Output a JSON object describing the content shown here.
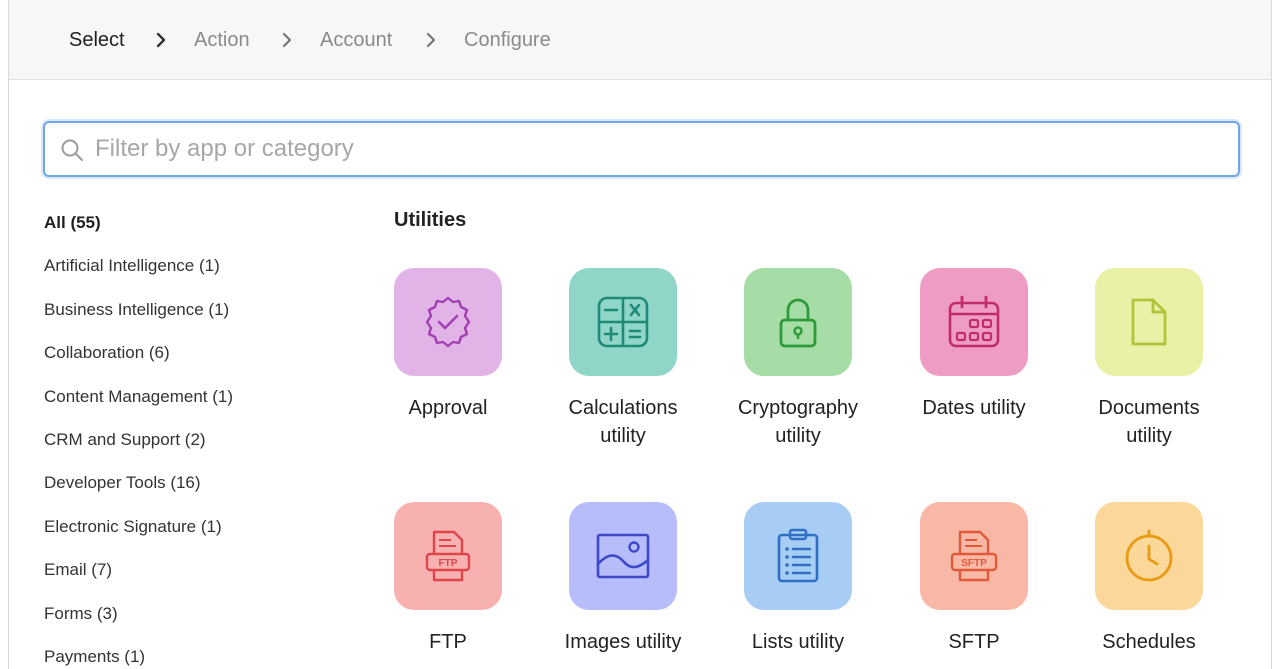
{
  "stepper": {
    "steps": [
      "Select",
      "Action",
      "Account",
      "Configure"
    ],
    "active_index": 0
  },
  "search": {
    "placeholder": "Filter by app or category",
    "value": ""
  },
  "categories": [
    {
      "label": "All (55)",
      "selected": true
    },
    {
      "label": "Artificial Intelligence (1)"
    },
    {
      "label": "Business Intelligence (1)"
    },
    {
      "label": "Collaboration (6)"
    },
    {
      "label": "Content Management (1)"
    },
    {
      "label": "CRM and Support (2)"
    },
    {
      "label": "Developer Tools (16)"
    },
    {
      "label": "Electronic Signature (1)"
    },
    {
      "label": "Email (7)"
    },
    {
      "label": "Forms (3)"
    },
    {
      "label": "Payments (1)"
    }
  ],
  "section": {
    "title": "Utilities"
  },
  "apps": [
    {
      "label": "Approval",
      "icon": "approval-badge-icon",
      "bg": "#e2b3e6",
      "fg": "#a23fb5"
    },
    {
      "label": "Calculations\nutility",
      "icon": "calculator-icon",
      "bg": "#8fd6c9",
      "fg": "#1f8a78"
    },
    {
      "label": "Cryptography\nutility",
      "icon": "lock-icon",
      "bg": "#a6dca6",
      "fg": "#2f9a3a"
    },
    {
      "label": "Dates utility",
      "icon": "calendar-icon",
      "bg": "#ee9cc4",
      "fg": "#c02b6e"
    },
    {
      "label": "Documents\nutility",
      "icon": "document-icon",
      "bg": "#eaf0a6",
      "fg": "#b5c33a"
    },
    {
      "label": "FTP",
      "icon": "ftp-file-icon",
      "bg": "#f7b1b1",
      "fg": "#e0454a"
    },
    {
      "label": "Images utility",
      "icon": "image-icon",
      "bg": "#b7bcfb",
      "fg": "#3d48c8"
    },
    {
      "label": "Lists utility",
      "icon": "clipboard-list-icon",
      "bg": "#a8cdf5",
      "fg": "#2f6fc4"
    },
    {
      "label": "SFTP",
      "icon": "sftp-file-icon",
      "bg": "#f9b8a5",
      "fg": "#e05a3a"
    },
    {
      "label": "Schedules",
      "icon": "clock-icon",
      "bg": "#fbd79a",
      "fg": "#e79a12"
    }
  ]
}
